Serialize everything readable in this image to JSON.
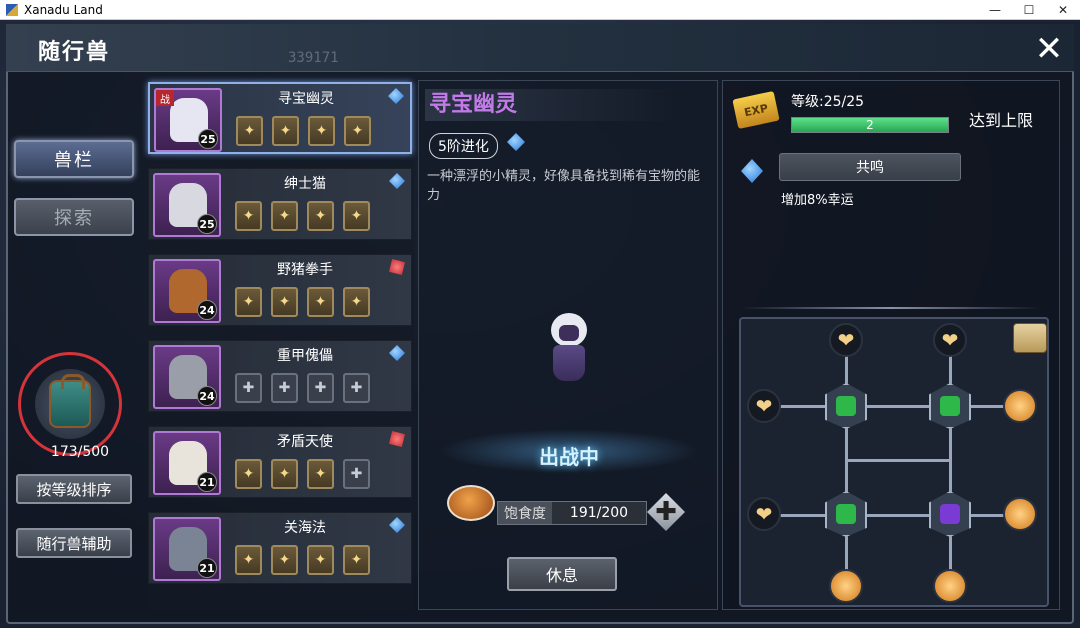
{
  "window": {
    "title": "Xanadu Land",
    "minimize": "—",
    "maximize": "☐",
    "close": "✕"
  },
  "header": {
    "title": "随行兽",
    "bg_number": "339171",
    "close": "✕"
  },
  "left": {
    "tab_active": "兽栏",
    "tab_inactive": "探索",
    "bag_count": "173/500",
    "sort_button": "按等级排序",
    "assist_button": "随行兽辅助"
  },
  "pets": [
    {
      "name": "寻宝幽灵",
      "level": "25",
      "type": "blue",
      "slots": [
        "filled",
        "filled",
        "filled",
        "filled"
      ],
      "battle_tag": "战",
      "color": "#e6e6f2"
    },
    {
      "name": "绅士猫",
      "level": "25",
      "type": "blue",
      "slots": [
        "filled",
        "filled",
        "filled",
        "filled"
      ],
      "color": "#d8d8e0"
    },
    {
      "name": "野猪拳手",
      "level": "24",
      "type": "red",
      "slots": [
        "filled",
        "filled",
        "filled",
        "filled"
      ],
      "color": "#b0682e"
    },
    {
      "name": "重甲傀儡",
      "level": "24",
      "type": "blue",
      "slots": [
        "empty",
        "empty",
        "empty",
        "empty"
      ],
      "color": "#9a9ea8"
    },
    {
      "name": "矛盾天使",
      "level": "21",
      "type": "red",
      "slots": [
        "filled",
        "filled",
        "filled",
        "empty"
      ],
      "color": "#e8e4dc"
    },
    {
      "name": "关海法",
      "level": "21",
      "type": "blue",
      "slots": [
        "filled",
        "filled",
        "filled",
        "filled"
      ],
      "color": "#7a8494"
    }
  ],
  "detail": {
    "name": "寻宝幽灵",
    "evolution": "5阶进化",
    "description": "一种漂浮的小精灵，好像具备找到稀有宝物的能力",
    "status": "出战中",
    "hunger_label": "饱食度",
    "hunger_value": "191/200",
    "plus": "✚",
    "rest_button": "休息"
  },
  "stats": {
    "exp_icon": "EXP",
    "level_text": "等级:25/25",
    "exp_value": "2",
    "exp_fraction": 1.0,
    "maxed": "达到上限",
    "resonance_button": "共鸣",
    "resonance_desc": "增加8%幸运"
  },
  "icons": {
    "slot_filled": "✦",
    "slot_empty": "✚",
    "heart": "❤"
  }
}
